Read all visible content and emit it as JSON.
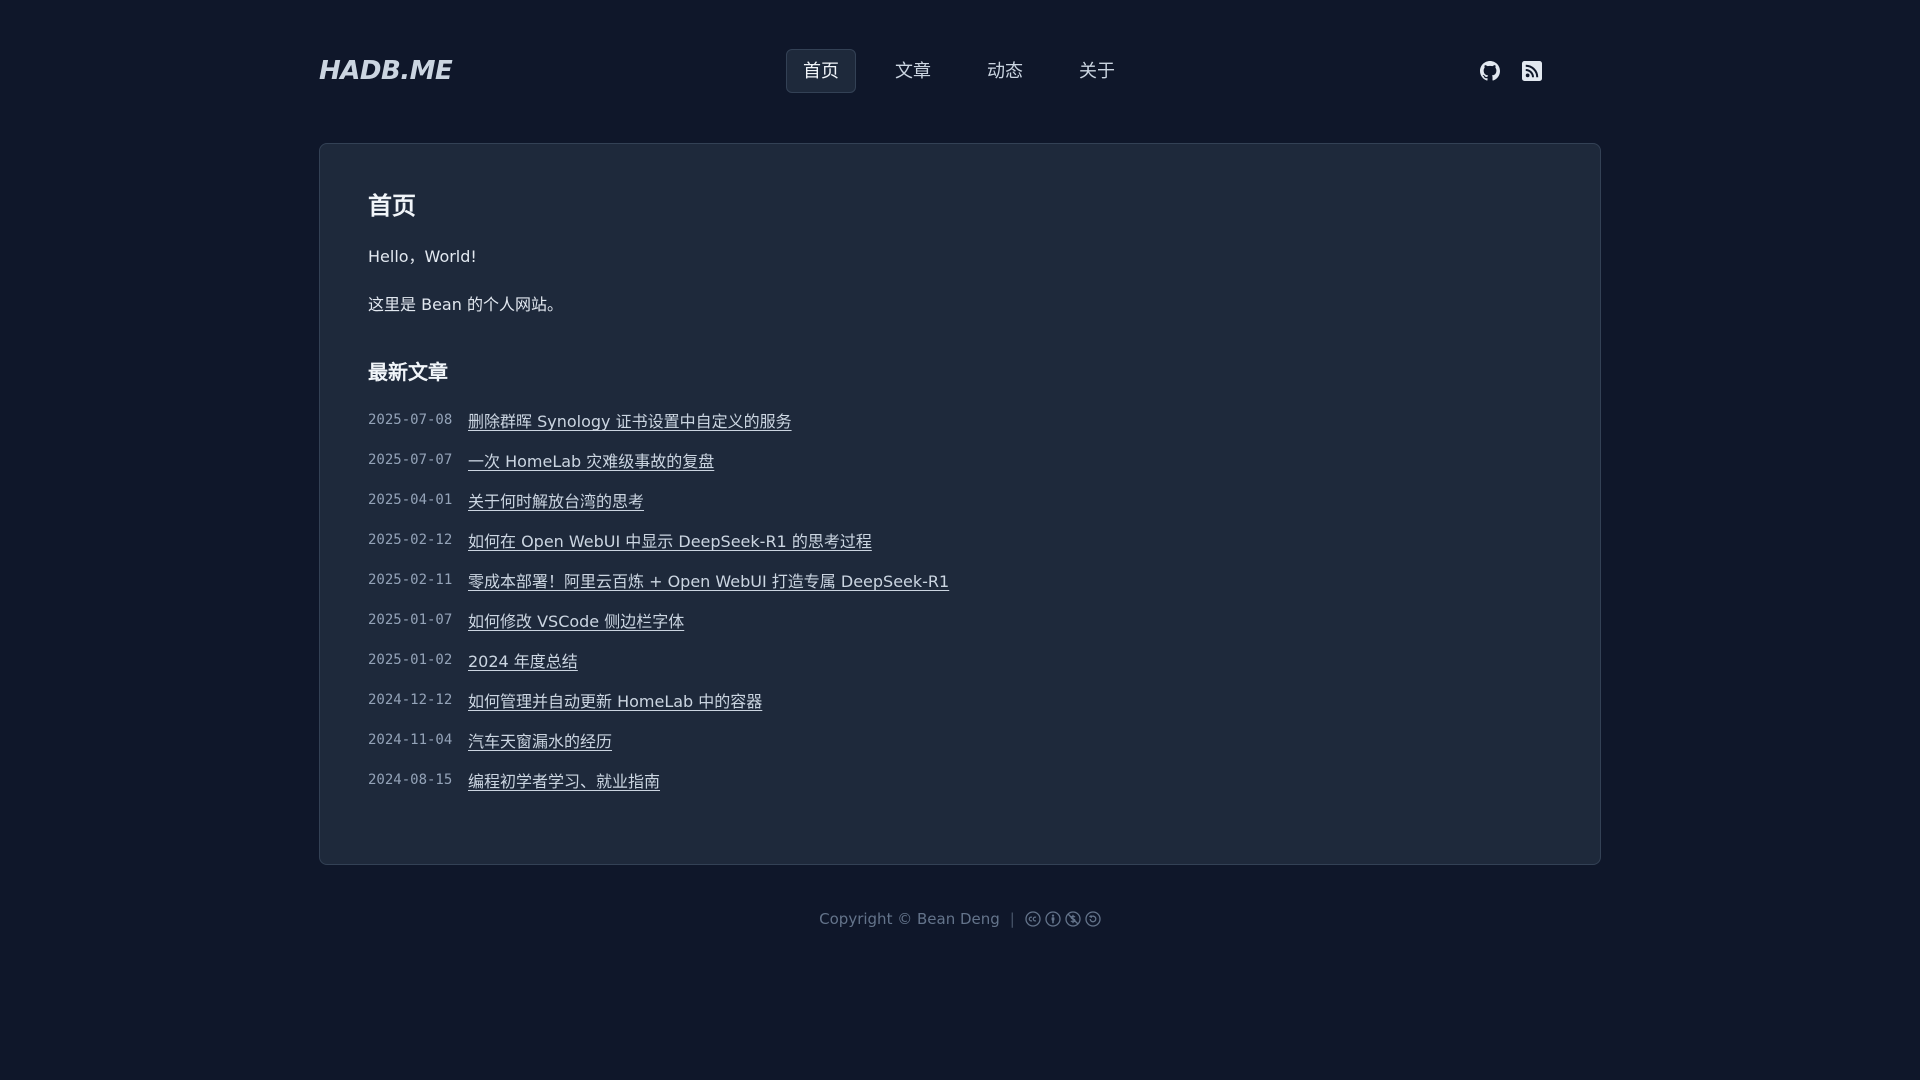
{
  "header": {
    "logo": "HADB.ME",
    "nav": [
      {
        "label": "首页",
        "active": true
      },
      {
        "label": "文章",
        "active": false
      },
      {
        "label": "动态",
        "active": false
      },
      {
        "label": "关于",
        "active": false
      }
    ],
    "icons": [
      "github-icon",
      "rss-icon"
    ]
  },
  "main": {
    "title": "首页",
    "paragraphs": [
      "Hello，World!",
      "这里是 Bean 的个人网站。"
    ],
    "section_title": "最新文章",
    "posts": [
      {
        "date": "2025-07-08",
        "title": "删除群晖 Synology 证书设置中自定义的服务"
      },
      {
        "date": "2025-07-07",
        "title": "一次 HomeLab 灾难级事故的复盘"
      },
      {
        "date": "2025-04-01",
        "title": "关于何时解放台湾的思考"
      },
      {
        "date": "2025-02-12",
        "title": "如何在 Open WebUI 中显示 DeepSeek-R1 的思考过程"
      },
      {
        "date": "2025-02-11",
        "title": "零成本部署！阿里云百炼 + Open WebUI 打造专属 DeepSeek-R1"
      },
      {
        "date": "2025-01-07",
        "title": "如何修改 VSCode 侧边栏字体"
      },
      {
        "date": "2025-01-02",
        "title": "2024 年度总结"
      },
      {
        "date": "2024-12-12",
        "title": "如何管理并自动更新 HomeLab 中的容器"
      },
      {
        "date": "2024-11-04",
        "title": "汽车天窗漏水的经历"
      },
      {
        "date": "2024-08-15",
        "title": "编程初学者学习、就业指南"
      }
    ]
  },
  "footer": {
    "copyright": "Copyright © Bean Deng",
    "separator": "|",
    "license_icons": [
      "cc-icon",
      "by-icon",
      "nc-icon",
      "sa-icon"
    ]
  },
  "colors": {
    "background": "#0f172a",
    "card": "#1e293b",
    "border": "#334155",
    "text": "#e2e8f0",
    "muted": "#94a3b8"
  }
}
